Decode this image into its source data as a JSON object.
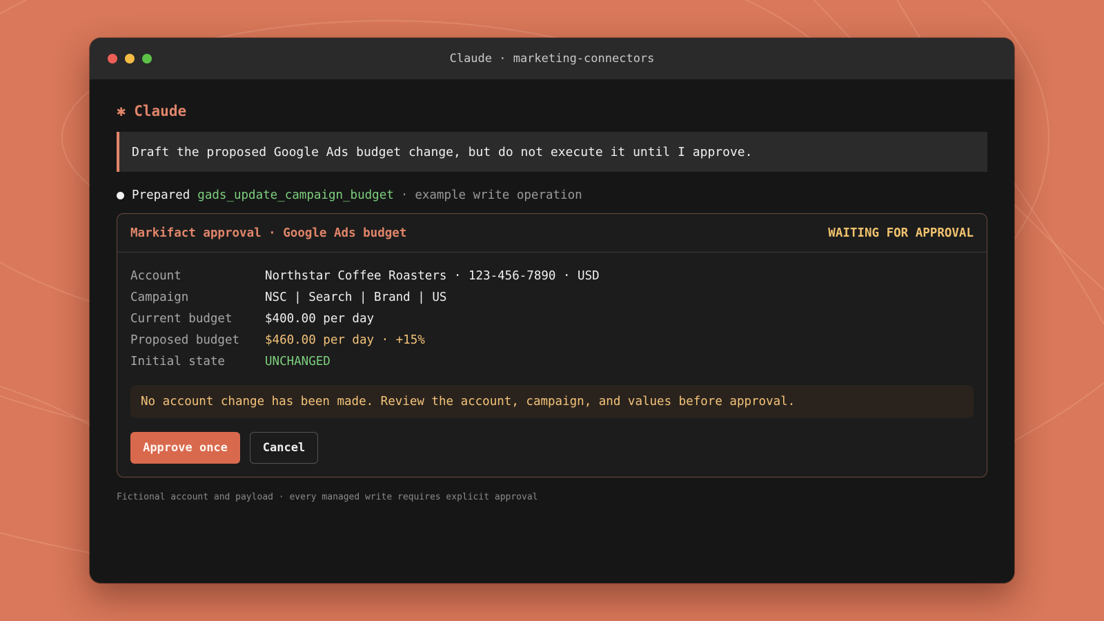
{
  "window": {
    "title": "Claude · marketing-connectors"
  },
  "brand": {
    "star_glyph": "✱",
    "name": "Claude"
  },
  "prompt": {
    "text": "Draft the proposed Google Ads budget change, but do not execute it until I approve."
  },
  "status_line": {
    "verb": "Prepared",
    "operation": "gads_update_campaign_budget",
    "separator": "·",
    "description": "example write operation"
  },
  "approval_card": {
    "title": "Markifact approval · Google Ads budget",
    "badge": "WAITING FOR APPROVAL",
    "fields": [
      {
        "label": "Account",
        "value": "Northstar Coffee Roasters · 123-456-7890 · USD"
      },
      {
        "label": "Campaign",
        "value": "NSC | Search | Brand | US"
      },
      {
        "label": "Current budget",
        "value": "$400.00 per day"
      },
      {
        "label": "Proposed budget",
        "value": "$460.00 per day · +15%"
      },
      {
        "label": "Initial state",
        "value": "UNCHANGED"
      }
    ],
    "notice": "No account change has been made. Review the account, campaign, and values before approval.",
    "approve_label": "Approve once",
    "cancel_label": "Cancel"
  },
  "footnote": "Fictional account and payload · every managed write requires explicit approval",
  "colors": {
    "background": "#d9785a",
    "window": "#161616",
    "accent": "#e1856a",
    "badge": "#f1c26e",
    "success": "#7dcf7f",
    "primary_button": "#d9694d"
  }
}
